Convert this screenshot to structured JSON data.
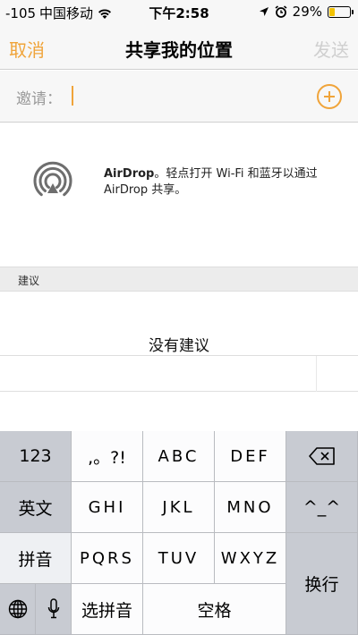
{
  "status_bar": {
    "signal": "-105",
    "carrier": "中国移动",
    "time": "下午2:58",
    "battery_percent": "29%",
    "battery_level": 0.29,
    "icons": [
      "wifi-icon",
      "location-arrow-icon",
      "alarm-icon",
      "battery-icon"
    ]
  },
  "nav": {
    "cancel_label": "取消",
    "title": "共享我的位置",
    "send_label": "发送"
  },
  "invite": {
    "label": "邀请："
  },
  "airdrop": {
    "bold_text": "AirDrop",
    "description": "。轻点打开 Wi-Fi 和蓝牙以通过 AirDrop 共享。"
  },
  "suggestions": {
    "header": "建议",
    "empty_text": "没有建议"
  },
  "keyboard": {
    "numbers_label": "123",
    "punct_label": ",。?!",
    "abc_label": "ABC",
    "def_label": "DEF",
    "english_label": "英文",
    "ghi_label": "GHI",
    "jkl_label": "JKL",
    "mno_label": "MNO",
    "emoticon_label": "^_^",
    "pinyin_label": "拼音",
    "pqrs_label": "PQRS",
    "tuv_label": "TUV",
    "wxyz_label": "WXYZ",
    "return_label": "换行",
    "select_pinyin_label": "选拼音",
    "space_label": "空格"
  },
  "colors": {
    "accent": "#f0a43a",
    "disabled": "#cfcfcf"
  }
}
